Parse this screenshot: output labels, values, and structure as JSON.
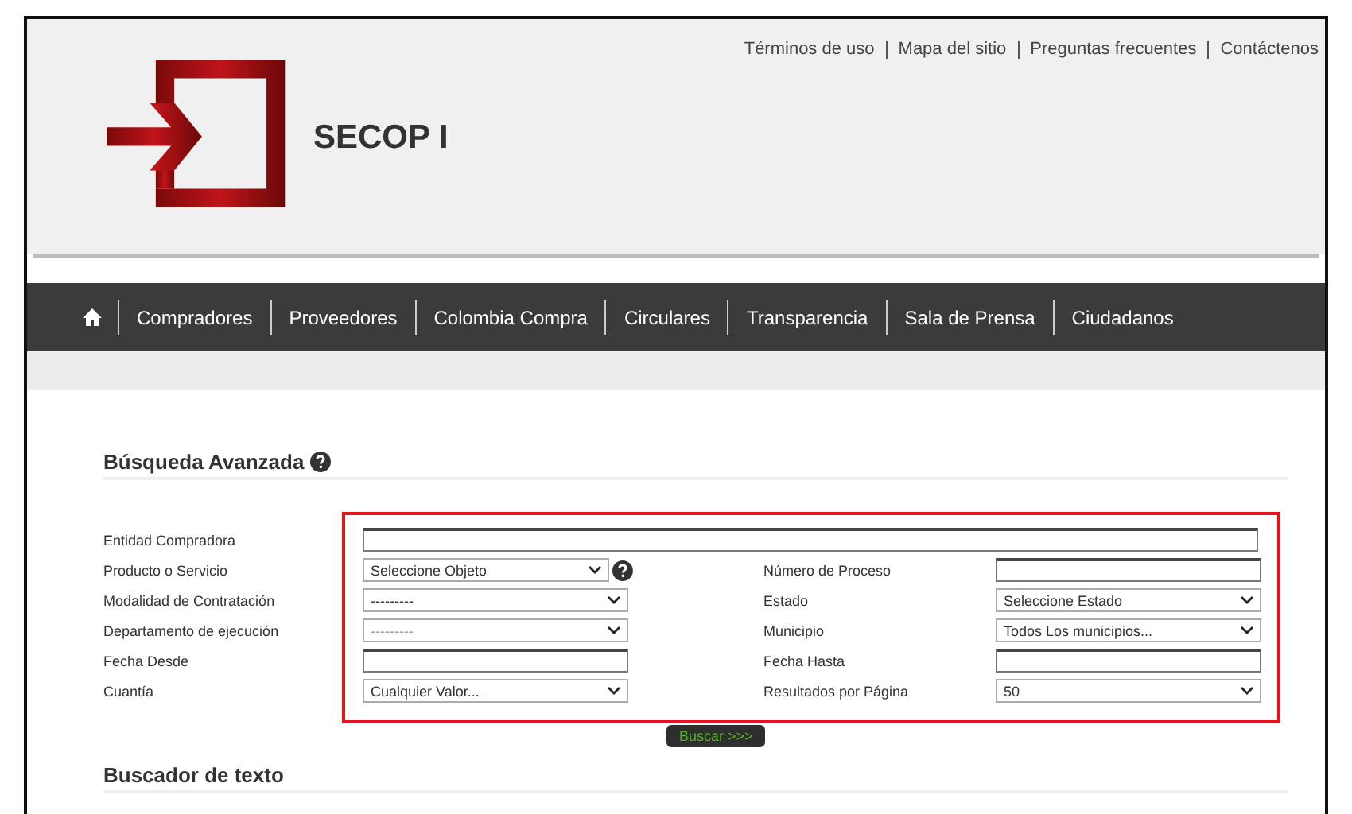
{
  "top_links": [
    "Términos de uso",
    "Mapa del sitio",
    "Preguntas frecuentes",
    "Contáctenos"
  ],
  "logo": {
    "title": "SECOP I"
  },
  "nav": {
    "items": [
      "Compradores",
      "Proveedores",
      "Colombia Compra",
      "Circulares",
      "Transparencia",
      "Sala de Prensa",
      "Ciudadanos"
    ]
  },
  "search": {
    "title": "Búsqueda Avanzada",
    "entity": {
      "label": "Entidad Compradora",
      "kind": "text"
    },
    "left": [
      {
        "label": "Producto o Servicio",
        "kind": "select",
        "value": "Seleccione Objeto",
        "disabled": false,
        "help": true
      },
      {
        "label": "Modalidad de Contratación",
        "kind": "select",
        "value": "---------",
        "disabled": false,
        "help": false
      },
      {
        "label": "Departamento de ejecución",
        "kind": "select",
        "value": "---------",
        "disabled": true,
        "help": false
      },
      {
        "label": "Fecha Desde",
        "kind": "text",
        "help": false
      },
      {
        "label": "Cuantía",
        "kind": "select",
        "value": "Cualquier Valor...",
        "disabled": false,
        "help": false
      }
    ],
    "right": [
      {
        "label": "Número de Proceso",
        "kind": "text"
      },
      {
        "label": "Estado",
        "kind": "select",
        "value": "Seleccione Estado",
        "disabled": false
      },
      {
        "label": "Municipio",
        "kind": "select",
        "value": "Todos Los municipios...",
        "disabled": false
      },
      {
        "label": "Fecha Hasta",
        "kind": "text"
      },
      {
        "label": "Resultados por Página",
        "kind": "select",
        "value": "50",
        "disabled": false
      }
    ],
    "button": "Buscar >>>"
  },
  "text_search": {
    "title": "Buscador de texto"
  }
}
